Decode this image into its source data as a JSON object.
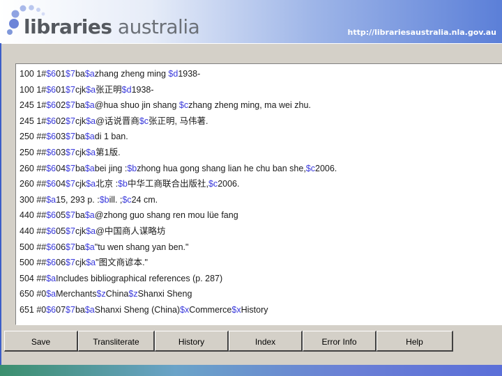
{
  "header": {
    "logo_bold": "libraries",
    "logo_light": " australia",
    "url": "http://librariesaustralia.nla.gov.au"
  },
  "colors": {
    "subfield": "#3a3adc",
    "text": "#1a1a1a",
    "window_gray": "#d4d0c8"
  },
  "record": {
    "lines": [
      [
        [
          "t",
          "100 1#"
        ],
        [
          "s",
          "$6"
        ],
        [
          "t",
          "01"
        ],
        [
          "s",
          "$7"
        ],
        [
          "t",
          "ba"
        ],
        [
          "s",
          "$a"
        ],
        [
          "t",
          "zhang zheng ming "
        ],
        [
          "s",
          "$d"
        ],
        [
          "t",
          "1938-"
        ]
      ],
      [
        [
          "t",
          "100 1#"
        ],
        [
          "s",
          "$6"
        ],
        [
          "t",
          "01"
        ],
        [
          "s",
          "$7"
        ],
        [
          "t",
          "cjk"
        ],
        [
          "s",
          "$a"
        ],
        [
          "t",
          "张正明"
        ],
        [
          "s",
          "$d"
        ],
        [
          "t",
          "1938-"
        ]
      ],
      [
        [
          "t",
          "245 1#"
        ],
        [
          "s",
          "$6"
        ],
        [
          "t",
          "02"
        ],
        [
          "s",
          "$7"
        ],
        [
          "t",
          "ba"
        ],
        [
          "s",
          "$a"
        ],
        [
          "t",
          "@hua shuo jin shang "
        ],
        [
          "s",
          "$c"
        ],
        [
          "t",
          "zhang zheng ming, ma wei zhu."
        ]
      ],
      [
        [
          "t",
          "245 1#"
        ],
        [
          "s",
          "$6"
        ],
        [
          "t",
          "02"
        ],
        [
          "s",
          "$7"
        ],
        [
          "t",
          "cjk"
        ],
        [
          "s",
          "$a"
        ],
        [
          "t",
          "@话说晋商"
        ],
        [
          "s",
          "$c"
        ],
        [
          "t",
          "张正明, 马伟著."
        ]
      ],
      [
        [
          "t",
          "250 ##"
        ],
        [
          "s",
          "$6"
        ],
        [
          "t",
          "03"
        ],
        [
          "s",
          "$7"
        ],
        [
          "t",
          "ba"
        ],
        [
          "s",
          "$a"
        ],
        [
          "t",
          "di 1 ban."
        ]
      ],
      [
        [
          "t",
          "250 ##"
        ],
        [
          "s",
          "$6"
        ],
        [
          "t",
          "03"
        ],
        [
          "s",
          "$7"
        ],
        [
          "t",
          "cjk"
        ],
        [
          "s",
          "$a"
        ],
        [
          "t",
          "第1版."
        ]
      ],
      [
        [
          "t",
          "260 ##"
        ],
        [
          "s",
          "$6"
        ],
        [
          "t",
          "04"
        ],
        [
          "s",
          "$7"
        ],
        [
          "t",
          "ba"
        ],
        [
          "s",
          "$a"
        ],
        [
          "t",
          "bei jing :"
        ],
        [
          "s",
          "$b"
        ],
        [
          "t",
          "zhong hua gong shang lian he chu ban she,"
        ],
        [
          "s",
          "$c"
        ],
        [
          "t",
          "2006."
        ]
      ],
      [
        [
          "t",
          "260 ##"
        ],
        [
          "s",
          "$6"
        ],
        [
          "t",
          "04"
        ],
        [
          "s",
          "$7"
        ],
        [
          "t",
          "cjk"
        ],
        [
          "s",
          "$a"
        ],
        [
          "t",
          "北京 :"
        ],
        [
          "s",
          "$b"
        ],
        [
          "t",
          "中华工商联合出版社,"
        ],
        [
          "s",
          "$c"
        ],
        [
          "t",
          "2006."
        ]
      ],
      [
        [
          "t",
          "300 ##"
        ],
        [
          "s",
          "$a"
        ],
        [
          "t",
          "15, 293 p. :"
        ],
        [
          "s",
          "$b"
        ],
        [
          "t",
          "ill. ;"
        ],
        [
          "s",
          "$c"
        ],
        [
          "t",
          "24 cm."
        ]
      ],
      [
        [
          "t",
          "440 ##"
        ],
        [
          "s",
          "$6"
        ],
        [
          "t",
          "05"
        ],
        [
          "s",
          "$7"
        ],
        [
          "t",
          "ba"
        ],
        [
          "s",
          "$a"
        ],
        [
          "t",
          "@zhong guo shang ren mou lüe fang"
        ]
      ],
      [
        [
          "t",
          "440 ##"
        ],
        [
          "s",
          "$6"
        ],
        [
          "t",
          "05"
        ],
        [
          "s",
          "$7"
        ],
        [
          "t",
          "cjk"
        ],
        [
          "s",
          "$a"
        ],
        [
          "t",
          "@中国商人谋略坊"
        ]
      ],
      [
        [
          "t",
          "500 ##"
        ],
        [
          "s",
          "$6"
        ],
        [
          "t",
          "06"
        ],
        [
          "s",
          "$7"
        ],
        [
          "t",
          "ba"
        ],
        [
          "s",
          "$a"
        ],
        [
          "t",
          "\"tu wen shang yan ben.\""
        ]
      ],
      [
        [
          "t",
          "500 ##"
        ],
        [
          "s",
          "$6"
        ],
        [
          "t",
          "06"
        ],
        [
          "s",
          "$7"
        ],
        [
          "t",
          "cjk"
        ],
        [
          "s",
          "$a"
        ],
        [
          "t",
          "\"图文商谚本.\""
        ]
      ],
      [
        [
          "t",
          "504 ##"
        ],
        [
          "s",
          "$a"
        ],
        [
          "t",
          "Includes bibliographical references (p. 287)"
        ]
      ],
      [
        [
          "t",
          "650 #0"
        ],
        [
          "s",
          "$a"
        ],
        [
          "t",
          "Merchants"
        ],
        [
          "s",
          "$z"
        ],
        [
          "t",
          "China"
        ],
        [
          "s",
          "$z"
        ],
        [
          "t",
          "Shanxi Sheng"
        ]
      ],
      [
        [
          "t",
          "651 #0"
        ],
        [
          "s",
          "$6"
        ],
        [
          "t",
          "07"
        ],
        [
          "s",
          "$7"
        ],
        [
          "t",
          "ba"
        ],
        [
          "s",
          "$a"
        ],
        [
          "t",
          "Shanxi Sheng (China)"
        ],
        [
          "s",
          "$x"
        ],
        [
          "t",
          "Commerce"
        ],
        [
          "s",
          "$x"
        ],
        [
          "t",
          "History"
        ]
      ]
    ]
  },
  "buttons": [
    {
      "name": "save-button",
      "label": "Save"
    },
    {
      "name": "transliterate-button",
      "label": "Transliterate"
    },
    {
      "name": "history-button",
      "label": "History"
    },
    {
      "name": "index-button",
      "label": "Index"
    },
    {
      "name": "error-info-button",
      "label": "Error Info"
    },
    {
      "name": "help-button",
      "label": "Help"
    }
  ]
}
